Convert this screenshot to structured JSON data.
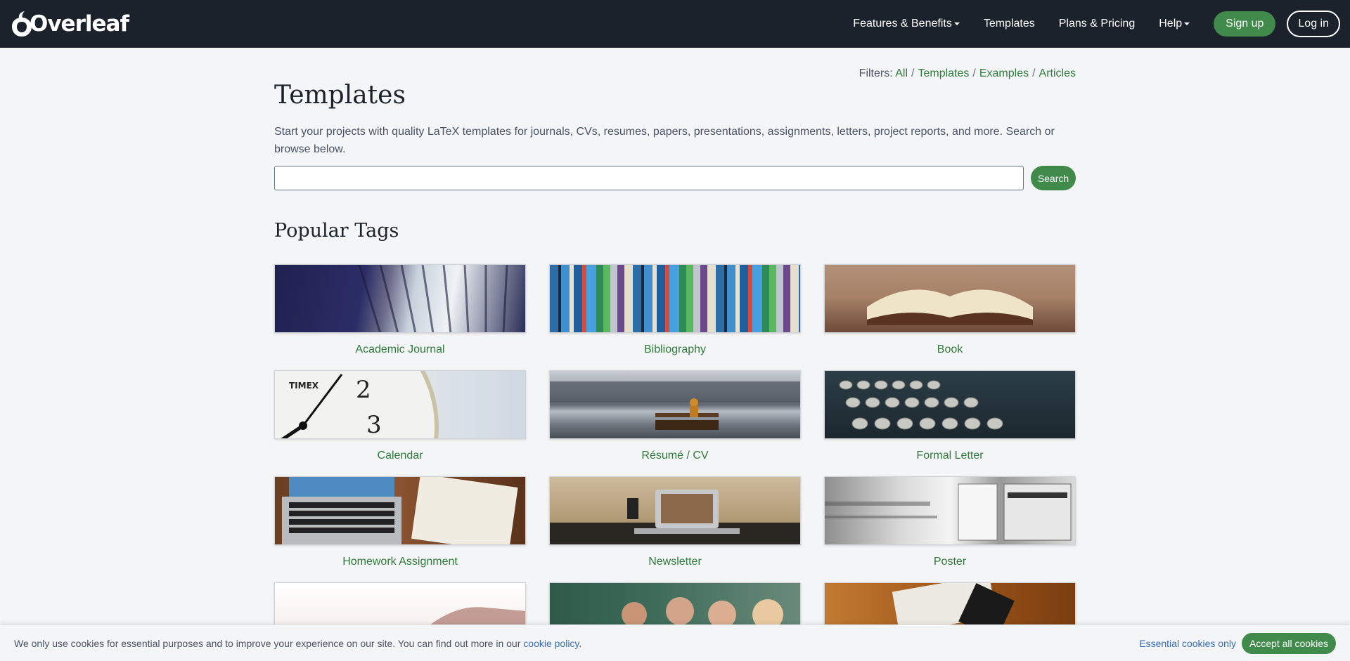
{
  "nav": {
    "logo": "Overleaf",
    "features": "Features & Benefits",
    "templates": "Templates",
    "pricing": "Plans & Pricing",
    "help": "Help",
    "signup": "Sign up",
    "login": "Log in"
  },
  "filters": {
    "prefix": "Filters:",
    "all": "All",
    "templates": "Templates",
    "examples": "Examples",
    "articles": "Articles",
    "separator": "/"
  },
  "page": {
    "title": "Templates",
    "intro": "Start your projects with quality LaTeX templates for journals, CVs, resumes, papers, presentations, assignments, letters, project reports, and more. Search or browse below.",
    "search_button": "Search",
    "search_value": "",
    "tags_title": "Popular Tags"
  },
  "tags": [
    {
      "label": "Academic Journal",
      "icon": "library-photo"
    },
    {
      "label": "Bibliography",
      "icon": "bookshelf-photo"
    },
    {
      "label": "Book",
      "icon": "open-book-photo"
    },
    {
      "label": "Calendar",
      "icon": "clock-photo"
    },
    {
      "label": "Résumé / CV",
      "icon": "bench-city-photo"
    },
    {
      "label": "Formal Letter",
      "icon": "typewriter-photo"
    },
    {
      "label": "Homework Assignment",
      "icon": "laptop-notebook-photo"
    },
    {
      "label": "Newsletter",
      "icon": "desk-laptop-photo"
    },
    {
      "label": "Poster",
      "icon": "poster-wall-photo"
    },
    {
      "label": "",
      "icon": "hills-photo"
    },
    {
      "label": "",
      "icon": "classroom-photo"
    },
    {
      "label": "",
      "icon": "magazine-photo"
    }
  ],
  "cookie": {
    "text": "We only use cookies for essential purposes and to improve your experience on our site. You can find out more in our",
    "link": "cookie policy",
    "period": ".",
    "essential": "Essential cookies only",
    "accept": "Accept all cookies"
  },
  "colors": {
    "nav_bg": "#1b222c",
    "accent_green": "#408a4b",
    "link_green": "#2f7a3b",
    "link_blue": "#366cbf",
    "page_bg": "#f4f5f6"
  }
}
